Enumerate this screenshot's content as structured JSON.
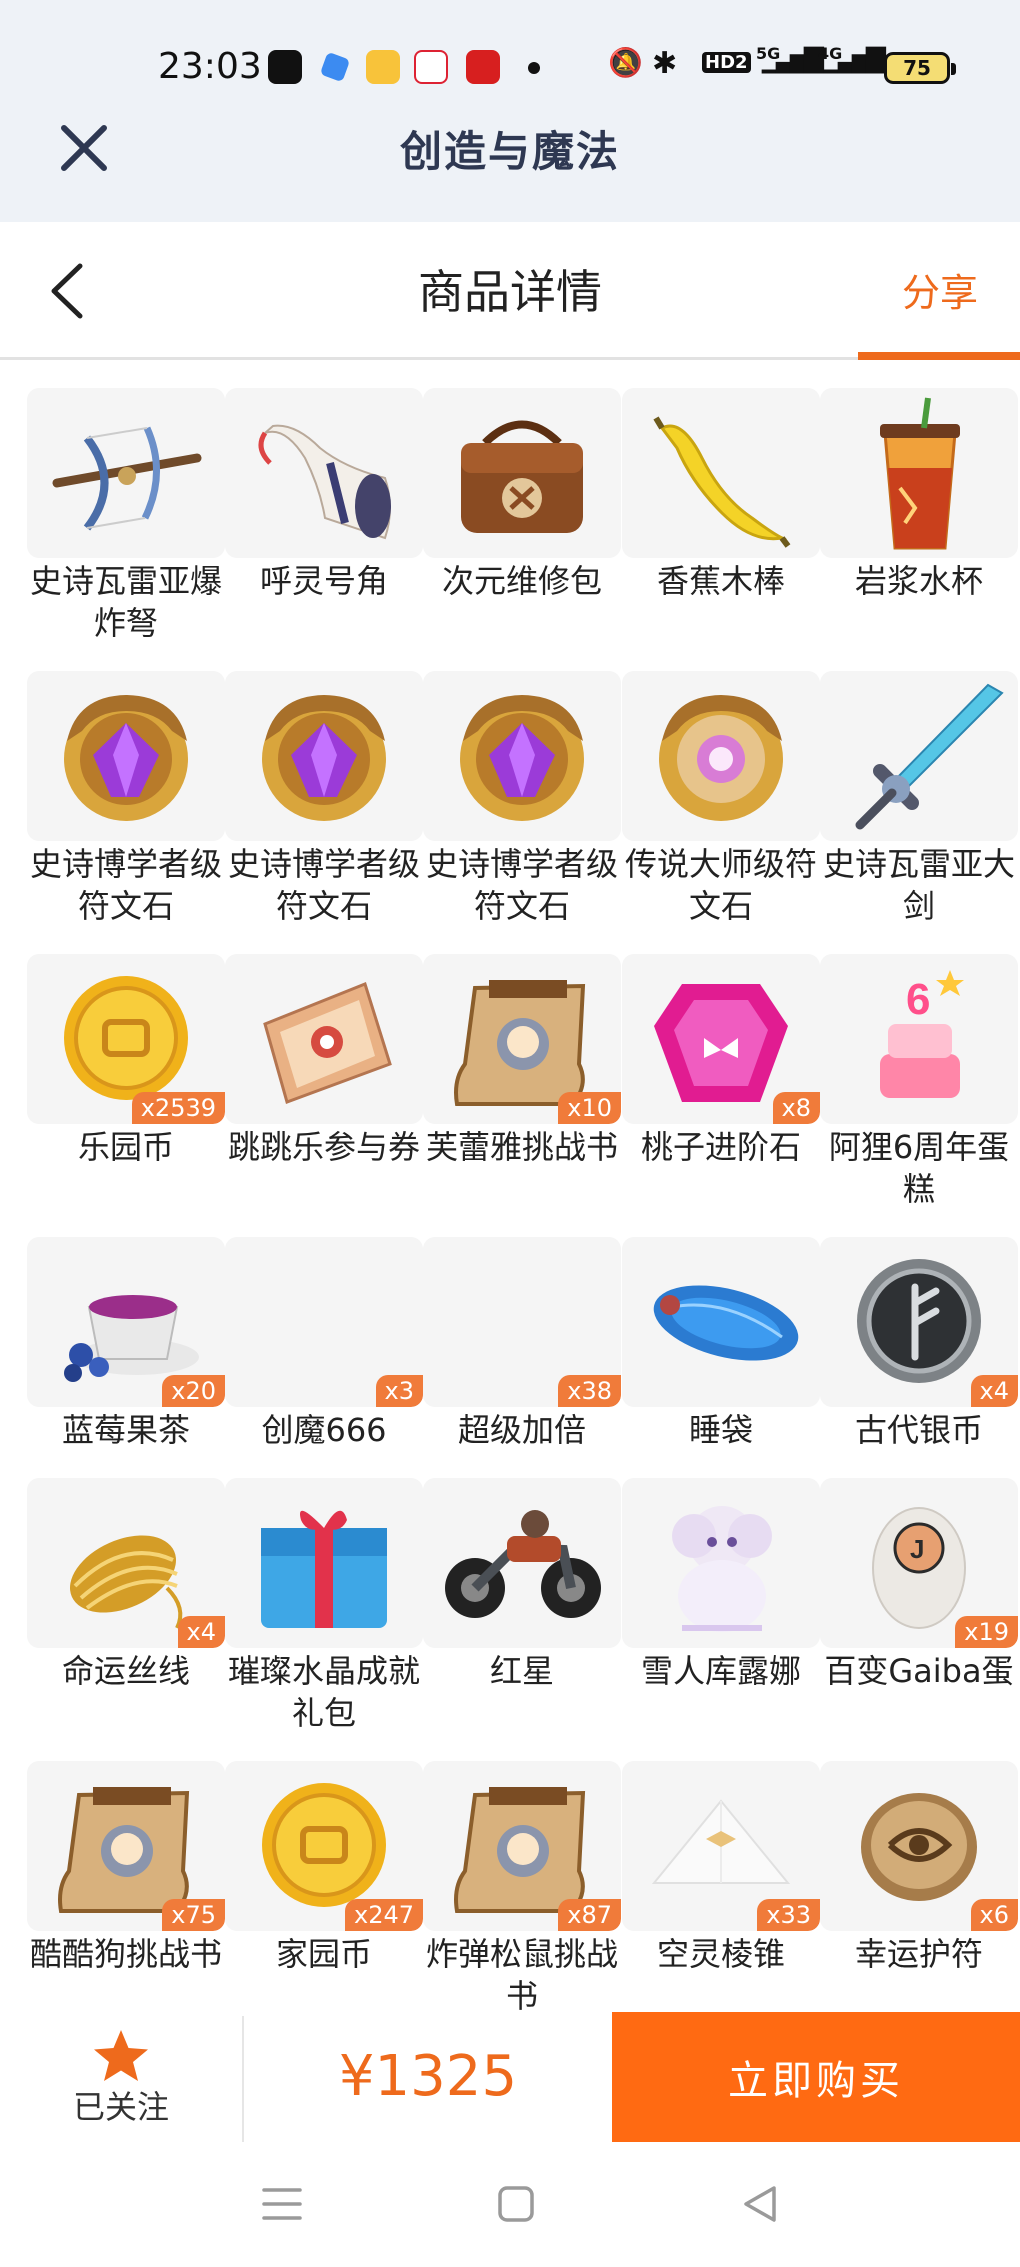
{
  "status_bar": {
    "time": "23:03",
    "network": "5G",
    "network2": "4G",
    "battery": "75",
    "icons": [
      "douyin-icon",
      "app-icon",
      "weibo-icon",
      "people-daily-icon",
      "xuexi-icon",
      "notification-dot",
      "mute-icon",
      "bluetooth-icon",
      "hd-icon",
      "signal-icon"
    ],
    "hd_label": "HD2"
  },
  "miniprogram": {
    "title": "创造与魔法",
    "close_icon": "close-icon"
  },
  "header": {
    "title": "商品详情",
    "share_label": "分享",
    "back_icon": "back-chevron-icon",
    "accent": "#ee6a1c"
  },
  "items": [
    {
      "name": "史诗瓦雷亚爆炸弩",
      "icon": "crossbow-icon",
      "badge": ""
    },
    {
      "name": "呼灵号角",
      "icon": "horn-icon",
      "badge": ""
    },
    {
      "name": "次元维修包",
      "icon": "repair-bag-icon",
      "badge": ""
    },
    {
      "name": "香蕉木棒",
      "icon": "banana-icon",
      "badge": ""
    },
    {
      "name": "岩浆水杯",
      "icon": "lava-cup-icon",
      "badge": ""
    },
    {
      "name": "史诗博学者级符文石",
      "icon": "rune-stone-purple-icon",
      "badge": ""
    },
    {
      "name": "史诗博学者级符文石",
      "icon": "rune-stone-purple-icon",
      "badge": ""
    },
    {
      "name": "史诗博学者级符文石",
      "icon": "rune-stone-purple-icon",
      "badge": ""
    },
    {
      "name": "传说大师级符文石",
      "icon": "rune-stone-legend-icon",
      "badge": ""
    },
    {
      "name": "史诗瓦雷亚大剑",
      "icon": "greatsword-icon",
      "badge": ""
    },
    {
      "name": "乐园币",
      "icon": "gold-coin-icon",
      "badge": "x2539"
    },
    {
      "name": "跳跳乐参与券",
      "icon": "ticket-icon",
      "badge": ""
    },
    {
      "name": "芙蕾雅挑战书",
      "icon": "wanted-poster-icon",
      "badge": "x10"
    },
    {
      "name": "桃子进阶石",
      "icon": "pink-gem-icon",
      "badge": "x8"
    },
    {
      "name": "阿狸6周年蛋糕",
      "icon": "cake-icon",
      "badge": ""
    },
    {
      "name": "蓝莓果茶",
      "icon": "tea-cup-icon",
      "badge": "x20"
    },
    {
      "name": "创魔666",
      "icon": "",
      "badge": "x3"
    },
    {
      "name": "超级加倍",
      "icon": "",
      "badge": "x38"
    },
    {
      "name": "睡袋",
      "icon": "sleeping-bag-icon",
      "badge": ""
    },
    {
      "name": "古代银币",
      "icon": "silver-coin-icon",
      "badge": "x4"
    },
    {
      "name": "命运丝线",
      "icon": "thread-icon",
      "badge": "x4"
    },
    {
      "name": "璀璨水晶成就礼包",
      "icon": "gift-box-icon",
      "badge": ""
    },
    {
      "name": "红星",
      "icon": "motorcycle-icon",
      "badge": ""
    },
    {
      "name": "雪人库露娜",
      "icon": "snow-creature-icon",
      "badge": ""
    },
    {
      "name": "百变Gaiba蛋",
      "icon": "egg-icon",
      "badge": "x19"
    },
    {
      "name": "酷酷狗挑战书",
      "icon": "wanted-poster-icon",
      "badge": "x75"
    },
    {
      "name": "家园币",
      "icon": "gold-coin-icon",
      "badge": "x247"
    },
    {
      "name": "炸弹松鼠挑战书",
      "icon": "wanted-poster-icon",
      "badge": "x87"
    },
    {
      "name": "空灵棱锥",
      "icon": "pyramid-icon",
      "badge": "x33"
    },
    {
      "name": "幸运护符",
      "icon": "amulet-icon",
      "badge": "x6"
    }
  ],
  "bottom_bar": {
    "follow_label": "已关注",
    "follow_icon": "star-icon",
    "price": "¥1325",
    "buy_label": "立即购买",
    "buy_color": "#ff6a12"
  },
  "nav": {
    "icons": [
      "menu-icon",
      "home-icon",
      "back-triangle-icon"
    ]
  }
}
